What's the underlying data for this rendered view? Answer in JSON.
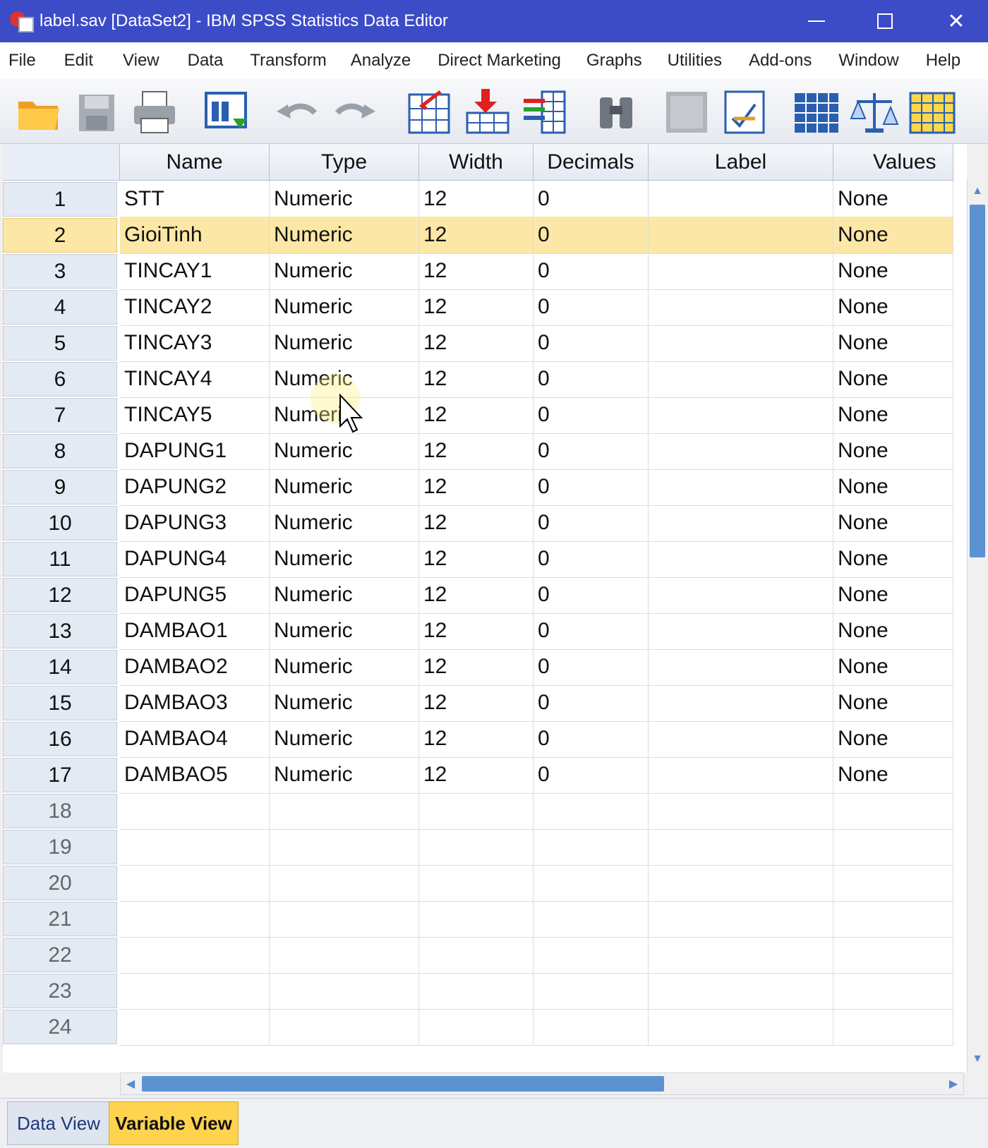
{
  "window": {
    "title": "label.sav [DataSet2] - IBM SPSS Statistics Data Editor"
  },
  "menu": [
    "File",
    "Edit",
    "View",
    "Data",
    "Transform",
    "Analyze",
    "Direct Marketing",
    "Graphs",
    "Utilities",
    "Add-ons",
    "Window",
    "Help"
  ],
  "toolbar": [
    "open-folder-icon",
    "save-icon",
    "print-icon",
    "dialog-recall-icon",
    "undo-icon",
    "redo-icon",
    "goto-case-icon",
    "goto-variable-icon",
    "variables-icon",
    "find-icon",
    "insert-cases-icon",
    "insert-variable-icon",
    "split-file-icon",
    "weight-cases-icon",
    "select-cases-icon"
  ],
  "columns": [
    "Name",
    "Type",
    "Width",
    "Decimals",
    "Label",
    "Values"
  ],
  "rows": [
    {
      "num": "1",
      "name": "STT",
      "type": "Numeric",
      "width": "12",
      "decimals": "0",
      "label": "",
      "values": "None"
    },
    {
      "num": "2",
      "name": "GioiTinh",
      "type": "Numeric",
      "width": "12",
      "decimals": "0",
      "label": "",
      "values": "None"
    },
    {
      "num": "3",
      "name": "TINCAY1",
      "type": "Numeric",
      "width": "12",
      "decimals": "0",
      "label": "",
      "values": "None"
    },
    {
      "num": "4",
      "name": "TINCAY2",
      "type": "Numeric",
      "width": "12",
      "decimals": "0",
      "label": "",
      "values": "None"
    },
    {
      "num": "5",
      "name": "TINCAY3",
      "type": "Numeric",
      "width": "12",
      "decimals": "0",
      "label": "",
      "values": "None"
    },
    {
      "num": "6",
      "name": "TINCAY4",
      "type": "Numeric",
      "width": "12",
      "decimals": "0",
      "label": "",
      "values": "None"
    },
    {
      "num": "7",
      "name": "TINCAY5",
      "type": "Numeric",
      "width": "12",
      "decimals": "0",
      "label": "",
      "values": "None"
    },
    {
      "num": "8",
      "name": "DAPUNG1",
      "type": "Numeric",
      "width": "12",
      "decimals": "0",
      "label": "",
      "values": "None"
    },
    {
      "num": "9",
      "name": "DAPUNG2",
      "type": "Numeric",
      "width": "12",
      "decimals": "0",
      "label": "",
      "values": "None"
    },
    {
      "num": "10",
      "name": "DAPUNG3",
      "type": "Numeric",
      "width": "12",
      "decimals": "0",
      "label": "",
      "values": "None"
    },
    {
      "num": "11",
      "name": "DAPUNG4",
      "type": "Numeric",
      "width": "12",
      "decimals": "0",
      "label": "",
      "values": "None"
    },
    {
      "num": "12",
      "name": "DAPUNG5",
      "type": "Numeric",
      "width": "12",
      "decimals": "0",
      "label": "",
      "values": "None"
    },
    {
      "num": "13",
      "name": "DAMBAO1",
      "type": "Numeric",
      "width": "12",
      "decimals": "0",
      "label": "",
      "values": "None"
    },
    {
      "num": "14",
      "name": "DAMBAO2",
      "type": "Numeric",
      "width": "12",
      "decimals": "0",
      "label": "",
      "values": "None"
    },
    {
      "num": "15",
      "name": "DAMBAO3",
      "type": "Numeric",
      "width": "12",
      "decimals": "0",
      "label": "",
      "values": "None"
    },
    {
      "num": "16",
      "name": "DAMBAO4",
      "type": "Numeric",
      "width": "12",
      "decimals": "0",
      "label": "",
      "values": "None"
    },
    {
      "num": "17",
      "name": "DAMBAO5",
      "type": "Numeric",
      "width": "12",
      "decimals": "0",
      "label": "",
      "values": "None"
    },
    {
      "num": "18",
      "name": "",
      "type": "",
      "width": "",
      "decimals": "",
      "label": "",
      "values": ""
    },
    {
      "num": "19",
      "name": "",
      "type": "",
      "width": "",
      "decimals": "",
      "label": "",
      "values": ""
    },
    {
      "num": "20",
      "name": "",
      "type": "",
      "width": "",
      "decimals": "",
      "label": "",
      "values": ""
    },
    {
      "num": "21",
      "name": "",
      "type": "",
      "width": "",
      "decimals": "",
      "label": "",
      "values": ""
    },
    {
      "num": "22",
      "name": "",
      "type": "",
      "width": "",
      "decimals": "",
      "label": "",
      "values": ""
    },
    {
      "num": "23",
      "name": "",
      "type": "",
      "width": "",
      "decimals": "",
      "label": "",
      "values": ""
    },
    {
      "num": "24",
      "name": "",
      "type": "",
      "width": "",
      "decimals": "",
      "label": "",
      "values": ""
    }
  ],
  "selected_row": 1,
  "tabs": {
    "data_view": "Data View",
    "variable_view": "Variable View",
    "active": "variable_view"
  },
  "colors": {
    "titlebar": "#3c4bc6",
    "selected_row": "#fde7a6",
    "active_tab": "#ffd34d",
    "scroll_thumb": "#5b93d2"
  }
}
